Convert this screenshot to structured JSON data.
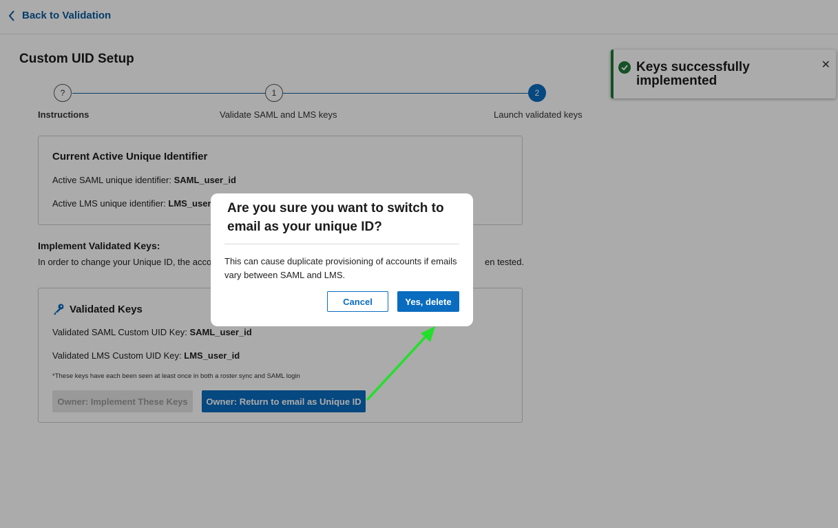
{
  "header": {
    "back_label": "Back to Validation"
  },
  "page": {
    "title": "Custom UID Setup"
  },
  "stepper": {
    "steps": [
      {
        "marker": "?",
        "label": "Instructions"
      },
      {
        "marker": "1",
        "label": "Validate SAML and LMS keys"
      },
      {
        "marker": "2",
        "label": "Launch validated keys"
      }
    ]
  },
  "current": {
    "title": "Current Active Unique Identifier",
    "saml_label": "Active SAML unique identifier:",
    "saml_value": "SAML_user_id",
    "lms_label": "Active LMS unique identifier:",
    "lms_value": "LMS_user_id"
  },
  "implement": {
    "title": "Implement Validated Keys:",
    "desc_start": "In order to change your Unique ID, the accou",
    "desc_end": "en tested."
  },
  "validated": {
    "title": "Validated Keys",
    "icon": "key-icon",
    "saml_label": "Validated SAML Custom UID Key:",
    "saml_value": "SAML_user_id",
    "lms_label": "Validated LMS Custom UID Key:",
    "lms_value": "LMS_user_id",
    "footnote": "*These keys have each been seen at least once in both a roster sync and SAML login",
    "implement_button": "Owner: Implement These Keys",
    "return_button": "Owner: Return to email as Unique ID"
  },
  "toast": {
    "message": "Keys successfully implemented",
    "close": "✕"
  },
  "modal": {
    "title": "Are you sure you want to switch to email as your unique ID?",
    "body": "This can cause duplicate provisioning of accounts if emails vary between SAML and LMS.",
    "cancel_label": "Cancel",
    "confirm_label": "Yes, delete"
  },
  "colors": {
    "primary": "#0a6cbf",
    "success": "#1f7a3a",
    "annotation_arrow": "#22e02a"
  }
}
